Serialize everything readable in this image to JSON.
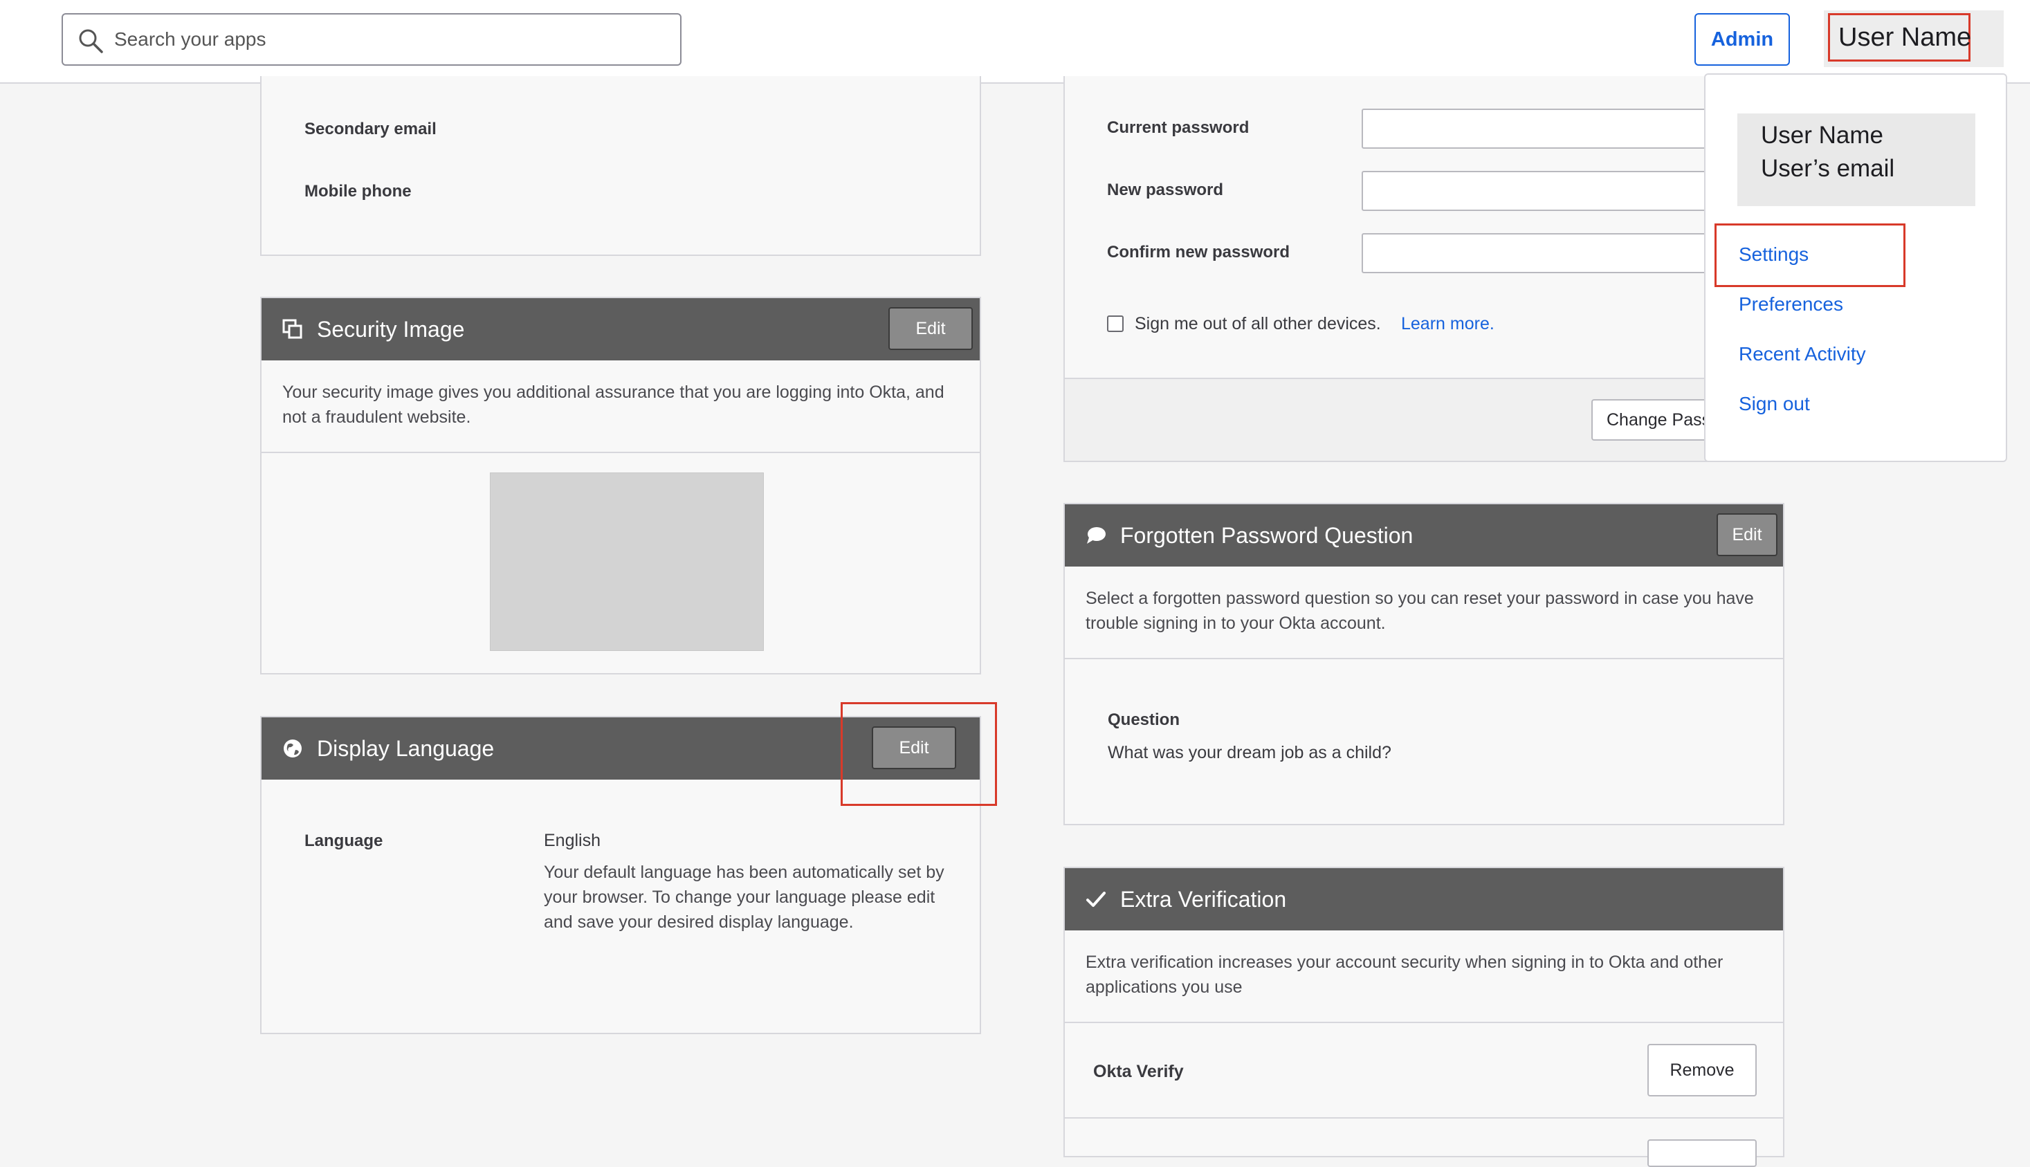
{
  "topbar": {
    "search_placeholder": "Search your apps",
    "admin_label": "Admin",
    "user_label": "User Name"
  },
  "personal_info": {
    "secondary_email_label": "Secondary email",
    "mobile_phone_label": "Mobile phone"
  },
  "security_image": {
    "title": "Security Image",
    "edit_label": "Edit",
    "description": "Your security image gives you additional assurance that you are logging into Okta, and not a fraudulent website."
  },
  "display_language": {
    "title": "Display Language",
    "edit_label": "Edit",
    "language_label": "Language",
    "language_value": "English",
    "language_note": "Your default language has been automatically set by your browser. To change your language please edit and save your desired display language."
  },
  "change_password": {
    "current_label": "Current password",
    "new_label": "New password",
    "confirm_label": "Confirm new password",
    "signout_label": "Sign me out of all other devices.",
    "learn_more": "Learn more.",
    "button_label": "Change Password"
  },
  "forgotten_question": {
    "title": "Forgotten Password Question",
    "edit_label": "Edit",
    "description": "Select a forgotten password question so you can reset your password in case you have trouble signing in to your Okta account.",
    "question_label": "Question",
    "question_value": "What was your dream job as a child?"
  },
  "extra_verification": {
    "title": "Extra Verification",
    "description": "Extra verification increases your account security when signing in to Okta and other applications you use",
    "okta_verify_label": "Okta Verify",
    "remove_label": "Remove"
  },
  "dropdown": {
    "user_name": "User Name",
    "user_email": "User’s email",
    "settings": "Settings",
    "preferences": "Preferences",
    "recent_activity": "Recent Activity",
    "sign_out": "Sign out"
  },
  "colors": {
    "accent": "#1662dd",
    "highlight": "#d83a2a",
    "header": "#5d5d5d"
  }
}
